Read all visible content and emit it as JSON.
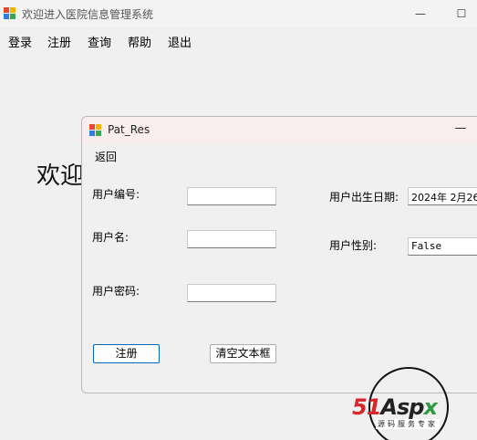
{
  "main_window": {
    "title": "欢迎进入医院信息管理系统",
    "minimize_glyph": "—",
    "maximize_glyph": "☐"
  },
  "menu": [
    "登录",
    "注册",
    "查询",
    "帮助",
    "退出"
  ],
  "background_text": "欢迎",
  "dialog": {
    "title": "Pat_Res",
    "minimize_glyph": "—",
    "menu_back": "返回",
    "labels": {
      "user_id": "用户编号:",
      "user_name": "用户名:",
      "password": "用户密码:",
      "birth_date": "用户出生日期:",
      "gender": "用户性别:"
    },
    "fields": {
      "user_id": "",
      "user_name": "",
      "password": "",
      "birth_date": "2024年 2月26",
      "gender": "False"
    },
    "buttons": {
      "register": "注册",
      "clear": "清空文本框"
    }
  },
  "watermark": {
    "brand_a": "51",
    "brand_b": "Asp",
    "brand_c": "x",
    "subtitle": "源码服务专家"
  },
  "icon_colors": [
    "#e24a2f",
    "#f5b400",
    "#2f7de1",
    "#35a853"
  ]
}
